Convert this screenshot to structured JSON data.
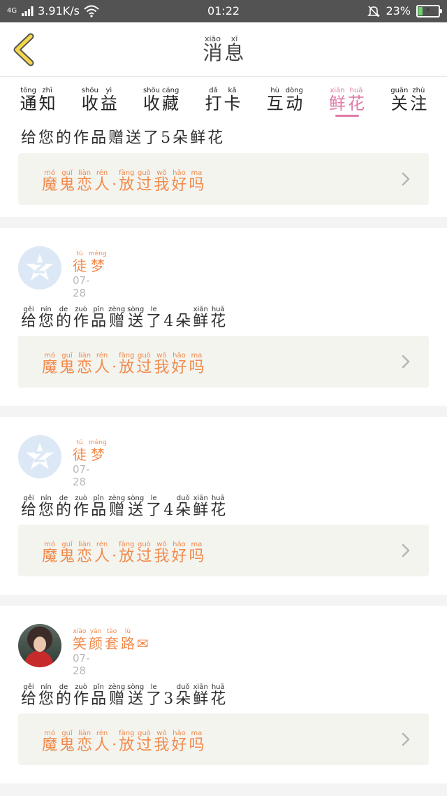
{
  "status_bar": {
    "network": "4G",
    "speed": "3.91K/s",
    "time": "01:22",
    "battery": "23%",
    "battery_level": 0.23,
    "icons": [
      "signal-icon",
      "wifi-icon",
      "silent-bell-icon",
      "battery-charging-icon"
    ]
  },
  "header": {
    "back_icon": "chevron-left-icon",
    "title": [
      {
        "py": "xiāo",
        "hz": "消"
      },
      {
        "py": "xī",
        "hz": "息"
      }
    ]
  },
  "tabs": [
    {
      "chars": [
        {
          "py": "tōng",
          "hz": "通"
        },
        {
          "py": "zhī",
          "hz": "知"
        }
      ],
      "active": false
    },
    {
      "chars": [
        {
          "py": "shōu",
          "hz": "收"
        },
        {
          "py": "yì",
          "hz": "益"
        }
      ],
      "active": false
    },
    {
      "chars": [
        {
          "py": "shōu",
          "hz": "收"
        },
        {
          "py": "cáng",
          "hz": "藏"
        }
      ],
      "active": false
    },
    {
      "chars": [
        {
          "py": "dǎ",
          "hz": "打"
        },
        {
          "py": "kǎ",
          "hz": "卡"
        }
      ],
      "active": false
    },
    {
      "chars": [
        {
          "py": "hù",
          "hz": "互"
        },
        {
          "py": "dòng",
          "hz": "动"
        }
      ],
      "active": false
    },
    {
      "chars": [
        {
          "py": "xiān",
          "hz": "鲜"
        },
        {
          "py": "huā",
          "hz": "花"
        }
      ],
      "active": true
    },
    {
      "chars": [
        {
          "py": "guān",
          "hz": "关"
        },
        {
          "py": "zhù",
          "hz": "注"
        }
      ],
      "active": false
    }
  ],
  "work_title": [
    {
      "py": "mó",
      "hz": "魔"
    },
    {
      "py": "guǐ",
      "hz": "鬼"
    },
    {
      "py": "liàn",
      "hz": "恋"
    },
    {
      "py": "rén",
      "hz": "人"
    },
    {
      "py": "",
      "hz": "·"
    },
    {
      "py": "fàng",
      "hz": "放"
    },
    {
      "py": "guò",
      "hz": "过"
    },
    {
      "py": "wǒ",
      "hz": "我"
    },
    {
      "py": "hǎo",
      "hz": "好"
    },
    {
      "py": "ma",
      "hz": "吗"
    }
  ],
  "messages": [
    {
      "partial": true,
      "text": [
        {
          "py": "",
          "hz": "给"
        },
        {
          "py": "",
          "hz": "您"
        },
        {
          "py": "",
          "hz": "的"
        },
        {
          "py": "",
          "hz": "作"
        },
        {
          "py": "",
          "hz": "品"
        },
        {
          "py": "",
          "hz": "赠"
        },
        {
          "py": "",
          "hz": "送"
        },
        {
          "py": "",
          "hz": "了"
        },
        {
          "py": "",
          "hz": "5"
        },
        {
          "py": "",
          "hz": "朵"
        },
        {
          "py": "",
          "hz": "鲜"
        },
        {
          "py": "",
          "hz": "花"
        }
      ]
    },
    {
      "partial": false,
      "avatar": "default-qq-avatar-icon",
      "nickname": [
        {
          "py": "tú",
          "hz": "徒"
        },
        {
          "py": "mèng",
          "hz": "梦"
        }
      ],
      "date": "07-28",
      "text": [
        {
          "py": "gěi",
          "hz": "给"
        },
        {
          "py": "nín",
          "hz": "您"
        },
        {
          "py": "de",
          "hz": "的"
        },
        {
          "py": "zuò",
          "hz": "作"
        },
        {
          "py": "pǐn",
          "hz": "品"
        },
        {
          "py": "zèng",
          "hz": "赠"
        },
        {
          "py": "sòng",
          "hz": "送"
        },
        {
          "py": "le",
          "hz": "了"
        },
        {
          "py": "",
          "hz": "4"
        },
        {
          "py": "",
          "hz": "朵"
        },
        {
          "py": "xiān",
          "hz": "鲜"
        },
        {
          "py": "huā",
          "hz": "花"
        }
      ]
    },
    {
      "partial": false,
      "avatar": "default-qq-avatar-icon",
      "nickname": [
        {
          "py": "tú",
          "hz": "徒"
        },
        {
          "py": "mèng",
          "hz": "梦"
        }
      ],
      "date": "07-28",
      "text": [
        {
          "py": "gěi",
          "hz": "给"
        },
        {
          "py": "nín",
          "hz": "您"
        },
        {
          "py": "de",
          "hz": "的"
        },
        {
          "py": "zuò",
          "hz": "作"
        },
        {
          "py": "pǐn",
          "hz": "品"
        },
        {
          "py": "zèng",
          "hz": "赠"
        },
        {
          "py": "sòng",
          "hz": "送"
        },
        {
          "py": "le",
          "hz": "了"
        },
        {
          "py": "",
          "hz": "4"
        },
        {
          "py": "duǒ",
          "hz": "朵"
        },
        {
          "py": "xiān",
          "hz": "鲜"
        },
        {
          "py": "huā",
          "hz": "花"
        }
      ]
    },
    {
      "partial": false,
      "avatar": "user-photo-avatar",
      "nickname": [
        {
          "py": "xiào",
          "hz": "笑"
        },
        {
          "py": "yán",
          "hz": "颜"
        },
        {
          "py": "tào",
          "hz": "套"
        },
        {
          "py": "lù",
          "hz": "路"
        },
        {
          "py": "",
          "hz": "✉"
        }
      ],
      "date": "07-28",
      "text": [
        {
          "py": "gěi",
          "hz": "给"
        },
        {
          "py": "nín",
          "hz": "您"
        },
        {
          "py": "de",
          "hz": "的"
        },
        {
          "py": "zuò",
          "hz": "作"
        },
        {
          "py": "pǐn",
          "hz": "品"
        },
        {
          "py": "zèng",
          "hz": "赠"
        },
        {
          "py": "sòng",
          "hz": "送"
        },
        {
          "py": "le",
          "hz": "了"
        },
        {
          "py": "",
          "hz": "3"
        },
        {
          "py": "duǒ",
          "hz": "朵"
        },
        {
          "py": "xiān",
          "hz": "鲜"
        },
        {
          "py": "huā",
          "hz": "花"
        }
      ]
    }
  ]
}
